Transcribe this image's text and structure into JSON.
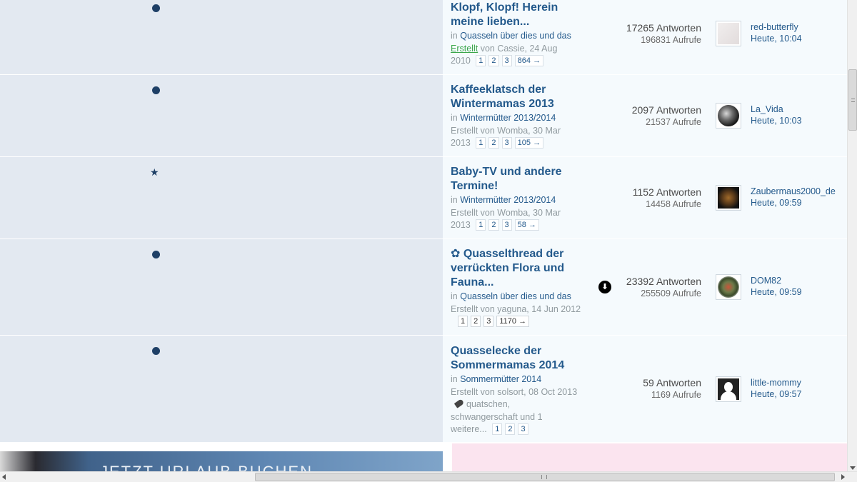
{
  "threads": [
    {
      "title": "Klopf, Klopf! Herein meine lieben...",
      "in_label": "in",
      "forum": "Quasseln über dies und das",
      "created_word": "Erstellt",
      "created_rest": "von Cassie, 24 Aug",
      "year": "2010",
      "pages": [
        "1",
        "2",
        "3",
        "864 →"
      ],
      "replies": "17265 Antworten",
      "views": "196831 Aufrufe",
      "last_user": "red-butterfly",
      "last_time": "Heute, 10:04",
      "icon": "dot-icon"
    },
    {
      "title": "Kaffeeklatsch der Wintermamas 2013",
      "in_label": "in",
      "forum": "Wintermütter 2013/2014",
      "created_line": "Erstellt von Womba, 30 Mar",
      "year": "2013",
      "pages": [
        "1",
        "2",
        "3",
        "105 →"
      ],
      "replies": "2097 Antworten",
      "views": "21537 Aufrufe",
      "last_user": "La_Vida",
      "last_time": "Heute, 10:03",
      "icon": "dot-icon"
    },
    {
      "title": "Baby-TV und andere Termine!",
      "in_label": "in",
      "forum": "Wintermütter 2013/2014",
      "created_line": "Erstellt von Womba, 30 Mar",
      "year": "2013",
      "pages": [
        "1",
        "2",
        "3",
        "58 →"
      ],
      "replies": "1152 Antworten",
      "views": "14458 Aufrufe",
      "last_user": "Zaubermaus2000_de",
      "last_time": "Heute, 09:59",
      "icon": "star-icon"
    },
    {
      "title": "✿ Quasselthread der verrückten Flora und Fauna...",
      "in_label": "in",
      "forum": "Quasseln über dies und das",
      "created_line": "Erstellt von yaguna, 14 Jun 2012",
      "pages": [
        "1",
        "2",
        "3",
        "1170 →"
      ],
      "replies": "23392 Antworten",
      "views": "255509 Aufrufe",
      "last_user": "DOM82",
      "last_time": "Heute, 09:59",
      "icon": "dot-icon"
    },
    {
      "title": "Quasselecke der Sommermamas 2014",
      "in_label": "in",
      "forum": "Sommermütter 2014",
      "created_line": "Erstellt von solsort, 08 Oct 2013",
      "tags_line1": "quatschen,",
      "tags_line2": "schwangerschaft und 1",
      "tags_line3": "weitere...",
      "pages": [
        "1",
        "2",
        "3"
      ],
      "replies": "59 Antworten",
      "views": "1169 Aufrufe",
      "last_user": "little-mommy",
      "last_time": "Heute, 09:57",
      "icon": "dot-icon"
    }
  ],
  "banner": {
    "text": "JETZT URLAUB BUCHEN"
  },
  "colors": {
    "title": "#245a8c",
    "left_bg": "#e3e9f1",
    "right_bg": "#f5fafd",
    "created_link": "#3aa64b"
  }
}
